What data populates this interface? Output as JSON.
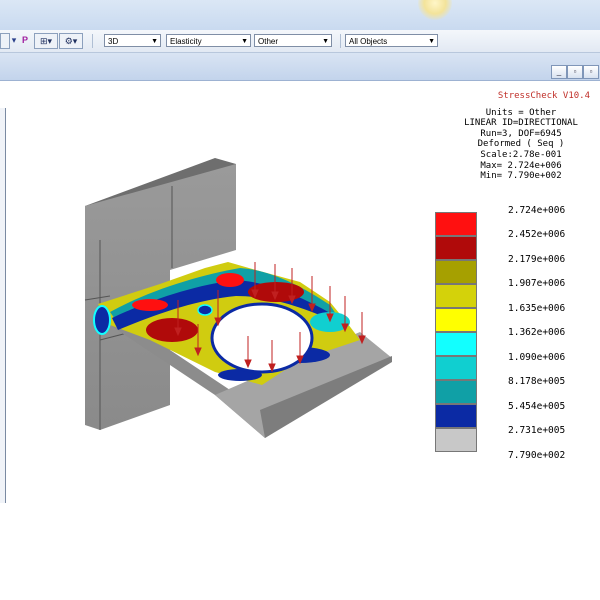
{
  "toolbar": {
    "mode_value": "3D",
    "material_value": "Elasticity",
    "category_value": "Other",
    "objects_value": "All Objects",
    "p_label": "P"
  },
  "info": {
    "app_version": "StressCheck V10.4",
    "units": "Units = Other",
    "solution_id": "LINEAR ID=DIRECTIONAL",
    "run": "Run=3, DOF=6945",
    "plot_type": "Deformed ( Seq )",
    "scale": "Scale:2.78e-001",
    "max": "Max= 2.724e+006",
    "min": "Min= 7.790e+002"
  },
  "legend": {
    "values": [
      "2.724e+006",
      "2.452e+006",
      "2.179e+006",
      "1.907e+006",
      "1.635e+006",
      "1.362e+006",
      "1.090e+006",
      "8.178e+005",
      "5.454e+005",
      "2.731e+005",
      "7.790e+002"
    ],
    "colors": [
      "#ff1010",
      "#b00a0a",
      "#a6a000",
      "#d4d20a",
      "#ffff00",
      "#12ffff",
      "#10cfd0",
      "#10a0a6",
      "#0b2aa4",
      "#c8c8c8"
    ]
  },
  "icons": [
    "dropdown-arrow-icon",
    "restore-window-icon",
    "minimize-window-icon",
    "tool-icon"
  ]
}
